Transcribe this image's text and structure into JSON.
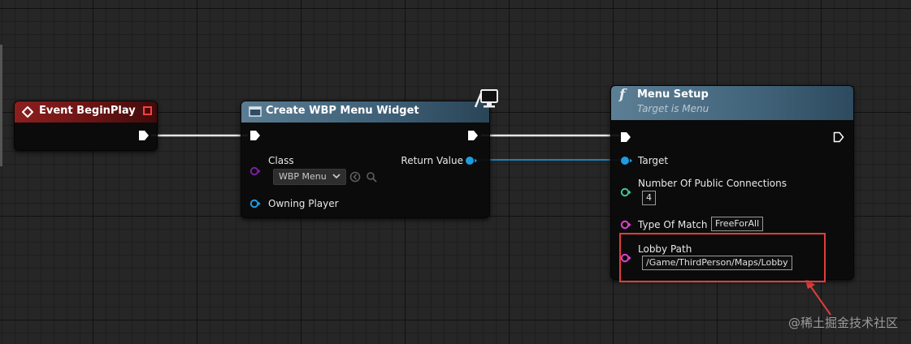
{
  "nodes": {
    "event_begin_play": {
      "title": "Event BeginPlay"
    },
    "create_widget": {
      "title": "Create WBP Menu Widget",
      "class_label": "Class",
      "class_value": "WBP Menu",
      "owning_player_label": "Owning Player",
      "return_value_label": "Return Value"
    },
    "menu_setup": {
      "title": "Menu Setup",
      "subtitle": "Target is Menu",
      "target_label": "Target",
      "connections_label": "Number Of Public Connections",
      "connections_value": "4",
      "type_of_match_label": "Type Of Match",
      "type_of_match_value": "FreeForAll",
      "lobby_path_label": "Lobby Path",
      "lobby_path_value": "/Game/ThirdPerson/Maps/Lobby"
    }
  },
  "colors": {
    "exec_wire": "#e6e6e6",
    "object_wire": "#1f9be0",
    "integer_pin": "#3ec49a",
    "string_pin": "#e03fd2",
    "class_pin": "#7b1fa2",
    "annotation": "#e23c3c"
  },
  "icons": {
    "event": "event-diamond-icon",
    "widget": "widget-rect-icon",
    "function": "function-f-icon",
    "client_only": "monitor-icon"
  },
  "watermark": "@稀土掘金技术社区"
}
